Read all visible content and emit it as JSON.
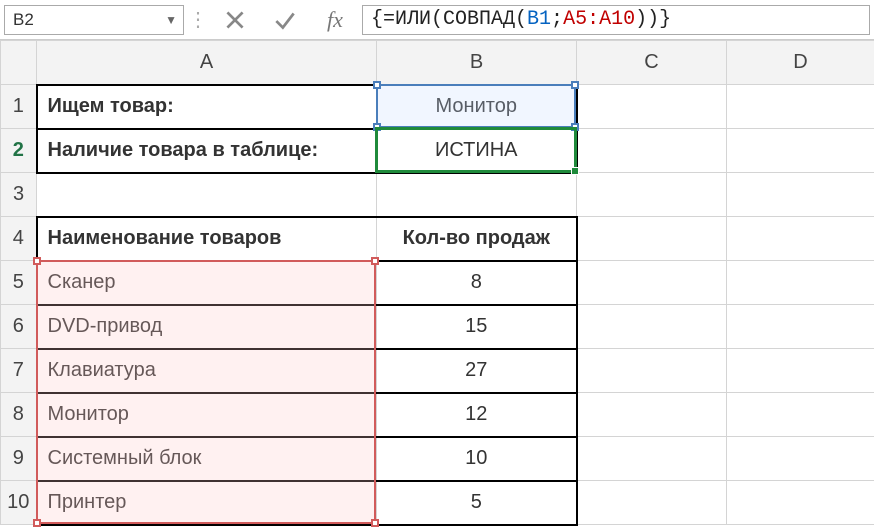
{
  "nameBox": "B2",
  "formula": {
    "prefix": "{=ИЛИ(СОВПАД(",
    "ref_blue": "B1",
    "sep": ";",
    "ref_red": "A5:A10",
    "suffix": "))}"
  },
  "columns": [
    "A",
    "B",
    "C",
    "D"
  ],
  "rows": [
    "1",
    "2",
    "3",
    "4",
    "5",
    "6",
    "7",
    "8",
    "9",
    "10"
  ],
  "cells": {
    "A1": "Ищем товар:",
    "B1": "Монитор",
    "A2": "Наличие товара в таблице:",
    "B2": "ИСТИНА",
    "A4": "Наименование товаров",
    "B4": "Кол-во продаж",
    "A5": "Сканер",
    "B5": "8",
    "A6": "DVD-привод",
    "B6": "15",
    "A7": "Клавиатура",
    "B7": "27",
    "A8": "Монитор",
    "B8": "12",
    "A9": "Системный блок",
    "B9": "10",
    "A10": "Принтер",
    "B10": "5"
  },
  "chart_data": {
    "type": "table",
    "title": "Наименование товаров / Кол-во продаж",
    "columns": [
      "Наименование товаров",
      "Кол-во продаж"
    ],
    "rows": [
      [
        "Сканер",
        8
      ],
      [
        "DVD-привод",
        15
      ],
      [
        "Клавиатура",
        27
      ],
      [
        "Монитор",
        12
      ],
      [
        "Системный блок",
        10
      ],
      [
        "Принтер",
        5
      ]
    ],
    "lookup": {
      "search_label": "Ищем товар:",
      "search_value": "Монитор",
      "result_label": "Наличие товара в таблице:",
      "result_value": "ИСТИНА"
    }
  }
}
